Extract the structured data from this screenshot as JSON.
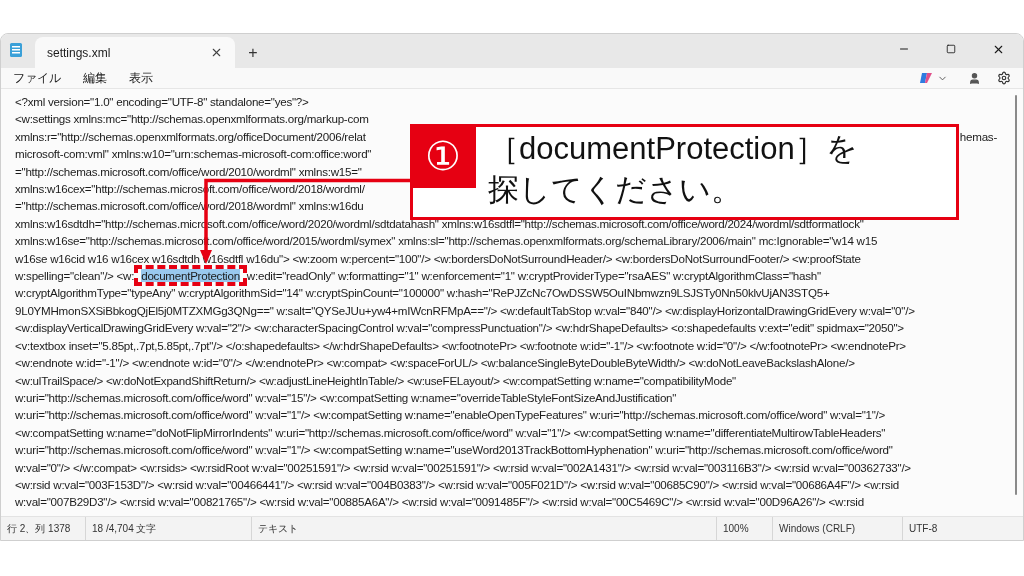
{
  "window": {
    "tabs": [
      {
        "label": "settings.xml",
        "selected": true
      }
    ],
    "new_tab": "+"
  },
  "menu": [
    "ファイル",
    "編集",
    "表示"
  ],
  "editor": {
    "lines": [
      {
        "kind": "plain",
        "text": "<?xml version=\"1.0\" encoding=\"UTF-8\" standalone=\"yes\"?>"
      },
      {
        "kind": "plain",
        "text": "<w:settings xmlns:mc=\"http://schemas.openxmlformats.org/markup-com"
      },
      {
        "kind": "plain",
        "text": "xmlns:r=\"http://schemas.openxmlformats.org/officeDocument/2006/relat",
        "tail": "hemas-"
      },
      {
        "kind": "plain",
        "text": "microsoft-com:vml\" xmlns:w10=\"urn:schemas-microsoft-com:office:word\""
      },
      {
        "kind": "plain",
        "text": "=\"http://schemas.microsoft.com/office/word/2010/wordml\" xmlns:w15=\""
      },
      {
        "kind": "plain",
        "text": "xmlns:w16cex=\"http://schemas.microsoft.com/office/word/2018/wordml/"
      },
      {
        "kind": "plain",
        "text": "=\"http://schemas.microsoft.com/office/word/2018/wordml\" xmlns:w16du"
      },
      {
        "kind": "plain",
        "text": "xmlns:w16sdtdh=\"http://schemas.microsoft.com/office/word/2020/wordml/sdtdatahash\" xmlns:w16sdtfl=\"http://schemas.microsoft.com/office/word/2024/wordml/sdtformatlock\""
      },
      {
        "kind": "plain",
        "text": "xmlns:w16se=\"http://schemas.microsoft.com/office/word/2015/wordml/symex\" xmlns:sl=\"http://schemas.openxmlformats.org/schemaLibrary/2006/main\" mc:Ignorable=\"w14 w15"
      },
      {
        "kind": "plain",
        "text": "w16se w16cid w16 w16cex w16sdtdh w16sdtfl w16du\"> <w:zoom w:percent=\"100\"/> <w:bordersDoNotSurroundHeader/> <w:bordersDoNotSurroundFooter/> <w:proofState"
      },
      {
        "kind": "selection",
        "before": "w:spelling=\"clean\"/> <w:",
        "selected_text": "documentProtection",
        "after": " w:edit=\"readOnly\" w:formatting=\"1\" w:enforcement=\"1\" w:cryptProviderType=\"rsaAES\" w:cryptAlgorithmClass=\"hash\""
      },
      {
        "kind": "plain",
        "text": "w:cryptAlgorithmType=\"typeAny\" w:cryptAlgorithmSid=\"14\" w:cryptSpinCount=\"100000\" w:hash=\"RePJZcNc7OwDSSW5OuINbmwzn9LSJSTy0Nn50klvUjAN3STQ5+"
      },
      {
        "kind": "plain",
        "text": "9L0YMHmonSXSiBbkogQjEl5j0MTZXMGg3QNg==\" w:salt=\"QYSeJUu+yw4+mIWcnRFMpA==\"/> <w:defaultTabStop w:val=\"840\"/> <w:displayHorizontalDrawingGridEvery w:val=\"0\"/>"
      },
      {
        "kind": "plain",
        "text": "<w:displayVerticalDrawingGridEvery w:val=\"2\"/> <w:characterSpacingControl w:val=\"compressPunctuation\"/> <w:hdrShapeDefaults> <o:shapedefaults v:ext=\"edit\" spidmax=\"2050\">"
      },
      {
        "kind": "plain",
        "text": "<v:textbox inset=\"5.85pt,.7pt,5.85pt,.7pt\"/> </o:shapedefaults> </w:hdrShapeDefaults> <w:footnotePr> <w:footnote w:id=\"-1\"/> <w:footnote w:id=\"0\"/> </w:footnotePr> <w:endnotePr>"
      },
      {
        "kind": "plain",
        "text": "<w:endnote w:id=\"-1\"/> <w:endnote w:id=\"0\"/> </w:endnotePr> <w:compat> <w:spaceForUL/> <w:balanceSingleByteDoubleByteWidth/> <w:doNotLeaveBackslashAlone/>"
      },
      {
        "kind": "plain",
        "text": "<w:ulTrailSpace/> <w:doNotExpandShiftReturn/> <w:adjustLineHeightInTable/> <w:useFELayout/> <w:compatSetting w:name=\"compatibilityMode\""
      },
      {
        "kind": "plain",
        "text": "w:uri=\"http://schemas.microsoft.com/office/word\" w:val=\"15\"/> <w:compatSetting w:name=\"overrideTableStyleFontSizeAndJustification\""
      },
      {
        "kind": "plain",
        "text": "w:uri=\"http://schemas.microsoft.com/office/word\" w:val=\"1\"/> <w:compatSetting w:name=\"enableOpenTypeFeatures\" w:uri=\"http://schemas.microsoft.com/office/word\" w:val=\"1\"/>"
      },
      {
        "kind": "plain",
        "text": "<w:compatSetting w:name=\"doNotFlipMirrorIndents\" w:uri=\"http://schemas.microsoft.com/office/word\" w:val=\"1\"/> <w:compatSetting w:name=\"differentiateMultirowTableHeaders\""
      },
      {
        "kind": "plain",
        "text": "w:uri=\"http://schemas.microsoft.com/office/word\" w:val=\"1\"/> <w:compatSetting w:name=\"useWord2013TrackBottomHyphenation\" w:uri=\"http://schemas.microsoft.com/office/word\""
      },
      {
        "kind": "plain",
        "text": "w:val=\"0\"/> </w:compat> <w:rsids> <w:rsidRoot w:val=\"00251591\"/> <w:rsid w:val=\"00251591\"/> <w:rsid w:val=\"002A1431\"/> <w:rsid w:val=\"003116B3\"/> <w:rsid w:val=\"00362733\"/>"
      },
      {
        "kind": "plain",
        "text": "<w:rsid w:val=\"003F153D\"/> <w:rsid w:val=\"00466441\"/> <w:rsid w:val=\"004B0383\"/> <w:rsid w:val=\"005F021D\"/> <w:rsid w:val=\"00685C90\"/> <w:rsid w:val=\"00686A4F\"/> <w:rsid"
      },
      {
        "kind": "plain",
        "text": "w:val=\"007B29D3\"/> <w:rsid w:val=\"00821765\"/> <w:rsid w:val=\"00885A6A\"/> <w:rsid w:val=\"0091485F\"/> <w:rsid w:val=\"00C5469C\"/> <w:rsid w:val=\"00D96A26\"/> <w:rsid"
      }
    ]
  },
  "status_bar": [
    "行 2、列 1378",
    "18 /4,704 文字",
    "テキスト",
    "100%",
    "Windows (CRLF)",
    "UTF-8"
  ],
  "callout": {
    "number": "①",
    "lines": [
      "［documentProtection］を",
      "探してください。"
    ]
  }
}
